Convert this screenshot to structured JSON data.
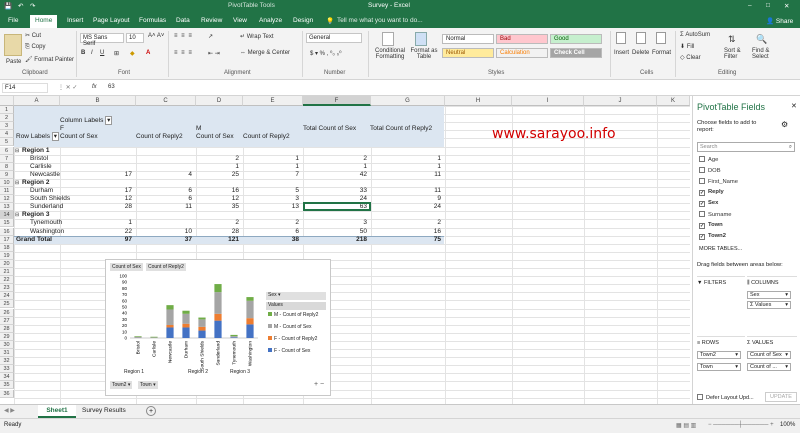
{
  "window": {
    "left_title": "PivotTable Tools",
    "title": "Survey - Excel",
    "user": "",
    "controls": [
      "–",
      "□",
      "✕"
    ]
  },
  "tabs": [
    "File",
    "Home",
    "Insert",
    "Page Layout",
    "Formulas",
    "Data",
    "Review",
    "View",
    "Analyze",
    "Design"
  ],
  "tell_me": "Tell me what you want to do...",
  "share": "Share",
  "ribbon": {
    "clipboard": {
      "paste": "Paste",
      "cut": "Cut",
      "copy": "Copy",
      "format_painter": "Format Painter",
      "label": "Clipboard"
    },
    "font": {
      "name": "MS Sans Serif",
      "size": "10",
      "label": "Font"
    },
    "alignment": {
      "wrap": "Wrap Text",
      "merge": "Merge & Center",
      "label": "Alignment"
    },
    "number": {
      "format": "General",
      "label": "Number"
    },
    "styles": {
      "cond": "Conditional Formatting",
      "table": "Format as Table",
      "normal": "Normal",
      "bad": "Bad",
      "good": "Good",
      "neutral": "Neutral",
      "calculation": "Calculation",
      "check": "Check Cell",
      "label": "Styles"
    },
    "cells": {
      "insert": "Insert",
      "delete": "Delete",
      "format": "Format",
      "label": "Cells"
    },
    "editing": {
      "autosum": "AutoSum",
      "fill": "Fill",
      "clear": "Clear",
      "sort": "Sort & Filter",
      "find": "Find & Select",
      "label": "Editing"
    }
  },
  "formula_bar": {
    "name_box": "F14",
    "fx": "fx",
    "value": "63"
  },
  "columns": [
    "A",
    "B",
    "C",
    "D",
    "E",
    "F",
    "G",
    "H",
    "I",
    "J",
    "K"
  ],
  "rows": [
    "1",
    "2",
    "3",
    "4",
    "5",
    "6",
    "7",
    "8",
    "9",
    "10",
    "11",
    "12",
    "13",
    "14",
    "15",
    "16",
    "17",
    "18",
    "19",
    "20",
    "21",
    "22",
    "23",
    "24",
    "25",
    "26",
    "27",
    "28",
    "29",
    "30",
    "31",
    "32",
    "33",
    "34",
    "35",
    "36"
  ],
  "pivot": {
    "column_labels": "Column Labels",
    "f": "F",
    "m": "M",
    "row_labels": "Row Labels",
    "headers": [
      "Count of Sex",
      "Count of Reply2",
      "Count of Sex",
      "Count of Reply2",
      "Total Count of Sex",
      "Total Count of Reply2"
    ],
    "rows": [
      {
        "label": "Region 1",
        "bold": true,
        "indent": 0,
        "vals": [
          "",
          "",
          "",
          "",
          "",
          ""
        ]
      },
      {
        "label": "Bristol",
        "bold": false,
        "indent": 1,
        "vals": [
          "",
          "",
          "2",
          "1",
          "2",
          "1"
        ]
      },
      {
        "label": "Carlisle",
        "bold": false,
        "indent": 1,
        "vals": [
          "",
          "",
          "1",
          "1",
          "1",
          "1"
        ]
      },
      {
        "label": "Newcastle",
        "bold": false,
        "indent": 1,
        "vals": [
          "17",
          "4",
          "25",
          "7",
          "42",
          "11"
        ]
      },
      {
        "label": "Region 2",
        "bold": true,
        "indent": 0,
        "vals": [
          "",
          "",
          "",
          "",
          "",
          ""
        ]
      },
      {
        "label": "Durham",
        "bold": false,
        "indent": 1,
        "vals": [
          "17",
          "6",
          "16",
          "5",
          "33",
          "11"
        ]
      },
      {
        "label": "South Shields",
        "bold": false,
        "indent": 1,
        "vals": [
          "12",
          "6",
          "12",
          "3",
          "24",
          "9"
        ]
      },
      {
        "label": "Sunderland",
        "bold": false,
        "indent": 1,
        "vals": [
          "28",
          "11",
          "35",
          "13",
          "63",
          "24"
        ]
      },
      {
        "label": "Region 3",
        "bold": true,
        "indent": 0,
        "vals": [
          "",
          "",
          "",
          "",
          "",
          ""
        ]
      },
      {
        "label": "Tynemouth",
        "bold": false,
        "indent": 1,
        "vals": [
          "1",
          "",
          "2",
          "2",
          "3",
          "2"
        ]
      },
      {
        "label": "Washington",
        "bold": false,
        "indent": 1,
        "vals": [
          "22",
          "10",
          "28",
          "6",
          "50",
          "16"
        ]
      },
      {
        "label": "Grand Total",
        "bold": true,
        "indent": 0,
        "vals": [
          "97",
          "37",
          "121",
          "38",
          "218",
          "75"
        ]
      }
    ]
  },
  "watermark": "www.sarayoo.info",
  "chart": {
    "buttons": [
      "Count of Sex",
      "Count of Reply2"
    ],
    "legend_field": "Sex",
    "legend_values": "Values",
    "axis_buttons": [
      "Town2",
      "Town"
    ],
    "region_labels": [
      "Region 1",
      "Region 2",
      "Region 3"
    ],
    "colors": {
      "f_sex": "#4472c4",
      "f_reply": "#ed7d31",
      "m_sex": "#a5a5a5",
      "m_reply": "#70ad47"
    }
  },
  "chart_data": {
    "type": "bar",
    "stacked": true,
    "categories": [
      "Bristol",
      "Carlisle",
      "Newcastle",
      "Durham",
      "South Shields",
      "Sunderland",
      "Tynemouth",
      "Washington"
    ],
    "series": [
      {
        "name": "F - Count of Sex",
        "values": [
          0,
          0,
          17,
          17,
          12,
          28,
          1,
          22
        ]
      },
      {
        "name": "F - Count of Reply2",
        "values": [
          0,
          0,
          4,
          6,
          6,
          11,
          0,
          10
        ]
      },
      {
        "name": "M - Count of Sex",
        "values": [
          2,
          1,
          25,
          16,
          12,
          35,
          2,
          28
        ]
      },
      {
        "name": "M - Count of Reply2",
        "values": [
          1,
          1,
          7,
          5,
          3,
          13,
          2,
          6
        ]
      }
    ],
    "yticks": [
      "0",
      "10",
      "20",
      "30",
      "40",
      "50",
      "60",
      "70",
      "80",
      "90",
      "100"
    ],
    "ylim": [
      0,
      100
    ]
  },
  "panel": {
    "title": "PivotTable Fields",
    "choose": "Choose fields to add to report:",
    "search_placeholder": "Search",
    "fields": [
      {
        "name": "Age",
        "checked": false
      },
      {
        "name": "DOB",
        "checked": false
      },
      {
        "name": "First_Name",
        "checked": false
      },
      {
        "name": "Reply",
        "checked": true
      },
      {
        "name": "Sex",
        "checked": true
      },
      {
        "name": "Surname",
        "checked": false
      },
      {
        "name": "Town",
        "checked": true
      },
      {
        "name": "Town2",
        "checked": true
      }
    ],
    "more_tables": "MORE TABLES...",
    "drag": "Drag fields between areas below:",
    "filters": "FILTERS",
    "columns_label": "COLUMNS",
    "columns_items": [
      "Sex",
      "Σ Values"
    ],
    "rows_label": "ROWS",
    "rows_items": [
      "Town2",
      "Town"
    ],
    "values_label": "VALUES",
    "values_items": [
      "Count of Sex",
      "Count of ..."
    ],
    "defer": "Defer Layout Upd...",
    "update": "UPDATE"
  },
  "sheets": {
    "active": "Sheet1",
    "other": "Survey Results",
    "add": "+"
  },
  "status": {
    "ready": "Ready",
    "zoom": "100%"
  }
}
